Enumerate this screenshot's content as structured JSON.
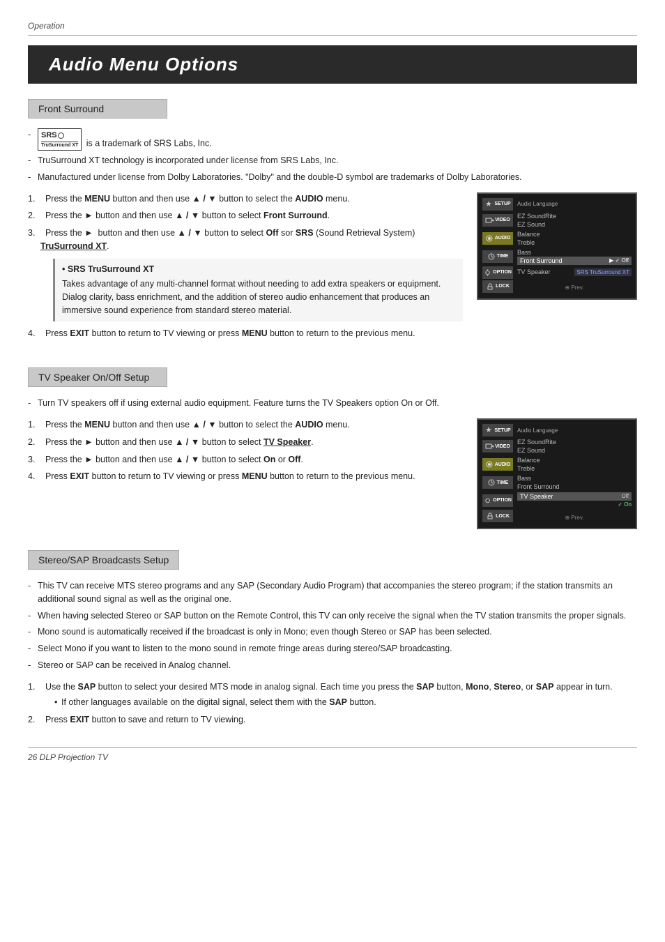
{
  "page": {
    "operation_label": "Operation",
    "bottom_label": "26  DLP Projection TV"
  },
  "title": "Audio Menu Options",
  "sections": {
    "front_surround": {
      "header": "Front Surround",
      "bullets": [
        "SRS is a trademark of SRS Labs, Inc.",
        "TruSurround XT technology is incorporated under license from SRS Labs, Inc.",
        "Manufactured under license from Dolby Laboratories. \"Dolby\" and the double-D symbol are trademarks of Dolby Laboratories."
      ],
      "steps": [
        "Press the MENU button and then use ▲ / ▼ button to select the AUDIO menu.",
        "Press the ► button and then use ▲ / ▼ button to select Front Surround.",
        "Press the ► button and then use ▲ / ▼ button to select Off sor SRS (Sound Retrieval System) TruSurround XT."
      ],
      "sub_section": {
        "title": "• SRS TruSurround XT",
        "body": "Takes advantage of any multi-channel format without needing to add extra speakers or equipment. Dialog clarity, bass enrichment, and the addition of stereo audio enhancement that produces an immersive sound experience from standard stereo material."
      },
      "step4": "Press EXIT button to return to TV viewing or press MENU button to return to the previous menu."
    },
    "tv_speaker": {
      "header": "TV Speaker On/Off Setup",
      "bullets": [
        "Turn TV speakers off if using external audio equipment. Feature turns the TV Speakers option On or Off."
      ],
      "steps": [
        "Press the MENU button and then use ▲ / ▼ button to select the AUDIO menu.",
        "Press the ► button and then use ▲ / ▼ button to select TV Speaker.",
        "Press the ► button and then use ▲ / ▼ button to select On or Off.",
        "Press EXIT button to return to TV viewing or press MENU button to return to the previous menu."
      ]
    },
    "stereo_sap": {
      "header": "Stereo/SAP Broadcasts Setup",
      "bullets": [
        "This TV can receive MTS stereo programs and any SAP (Secondary Audio Program) that accompanies the stereo program; if the station transmits an additional sound signal as well as the original one.",
        "When having selected Stereo or SAP button on the Remote Control, this TV can only receive the signal when the TV station transmits the proper signals.",
        "Mono sound is automatically received if the broadcast is only in Mono; even though Stereo or SAP has been selected.",
        "Select Mono if you want to listen to the mono sound in remote fringe areas during stereo/SAP broadcasting.",
        "Stereo or SAP can be received in Analog channel."
      ],
      "step1": "Use the SAP button to select your desired MTS mode in analog signal. Each time you press the SAP button, Mono, Stereo, or SAP appear in turn.",
      "step1_sub": "If other languages available on the digital signal, select them with the SAP button.",
      "step2": "Press EXIT button to save and return to TV viewing."
    }
  },
  "menu_screenshot_1": {
    "rows": [
      {
        "icon": "SETUP",
        "active": false,
        "label": "Audio Language",
        "value": ""
      },
      {
        "icon": "VIDEO",
        "active": false,
        "label": "EZ SoundRite",
        "value": ""
      },
      {
        "icon": "",
        "active": false,
        "label": "EZ Sound",
        "value": ""
      },
      {
        "icon": "AUDIO",
        "active": true,
        "label": "Balance",
        "value": ""
      },
      {
        "icon": "",
        "active": false,
        "label": "Treble",
        "value": ""
      },
      {
        "icon": "TIME",
        "active": false,
        "label": "Bass",
        "value": ""
      },
      {
        "icon": "",
        "active": false,
        "label": "Front Surround",
        "value": "▶  ✓ Off"
      },
      {
        "icon": "OPTION",
        "active": false,
        "label": "TV Speaker",
        "value": "SRS TruSurround XT"
      },
      {
        "icon": "LOCK",
        "active": false,
        "label": "⊕ Prev.",
        "value": ""
      }
    ]
  },
  "menu_screenshot_2": {
    "rows": [
      {
        "icon": "SETUP",
        "active": false,
        "label": "Audio Language",
        "value": ""
      },
      {
        "icon": "VIDEO",
        "active": false,
        "label": "EZ SoundRite",
        "value": ""
      },
      {
        "icon": "",
        "active": false,
        "label": "EZ Sound",
        "value": ""
      },
      {
        "icon": "AUDIO",
        "active": true,
        "label": "Balance",
        "value": ""
      },
      {
        "icon": "",
        "active": false,
        "label": "Treble",
        "value": ""
      },
      {
        "icon": "TIME",
        "active": false,
        "label": "Bass",
        "value": ""
      },
      {
        "icon": "",
        "active": false,
        "label": "Front Surround",
        "value": ""
      },
      {
        "icon": "OPTION",
        "active": false,
        "label": "TV Speaker",
        "value": "Off"
      },
      {
        "icon": "",
        "active": false,
        "label": "",
        "value": "✓ On"
      },
      {
        "icon": "LOCK",
        "active": false,
        "label": "⊕ Prev.",
        "value": ""
      }
    ]
  }
}
